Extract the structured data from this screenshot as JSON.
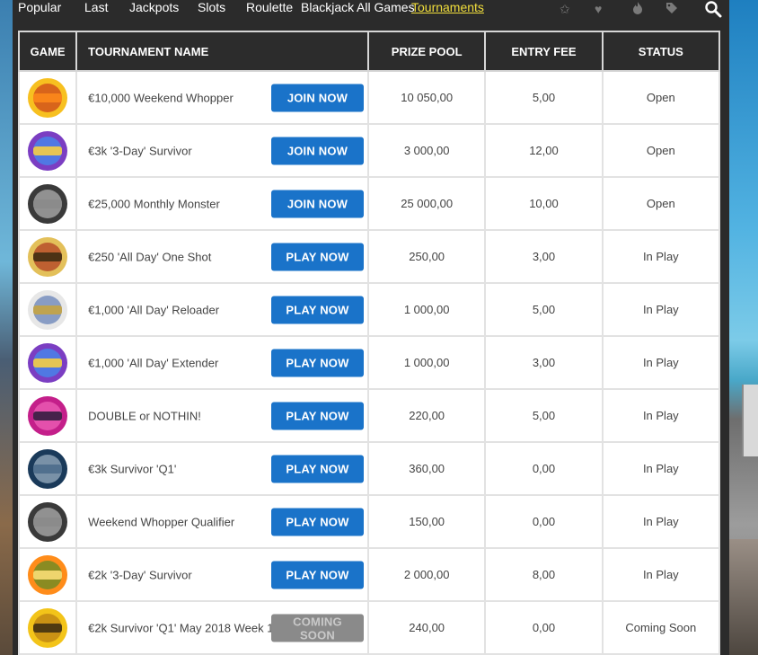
{
  "nav": {
    "links": [
      "Popular",
      "Last",
      "Jackpots",
      "Slots",
      "Roulette",
      "Blackjack",
      "All Games",
      "Tournaments"
    ],
    "active": "Tournaments",
    "icons": [
      "star-icon",
      "heart-icon",
      "fire-icon",
      "tag-icon",
      "search-icon"
    ]
  },
  "table": {
    "headers": {
      "game": "GAME",
      "name": "TOURNAMENT NAME",
      "prize": "PRIZE POOL",
      "fee": "ENTRY FEE",
      "status": "STATUS"
    },
    "rows": [
      {
        "name": "€10,000 Weekend Whopper",
        "button": "JOIN NOW",
        "prize": "10 050,00",
        "fee": "5,00",
        "status": "Open",
        "game_icon": "burning-desire-logo"
      },
      {
        "name": "€3k '3-Day' Survivor",
        "button": "JOIN NOW",
        "prize": "3 000,00",
        "fee": "12,00",
        "status": "Open",
        "game_icon": "lucky-witch-logo"
      },
      {
        "name": "€25,000 Monthly Monster",
        "button": "JOIN NOW",
        "prize": "25 000,00",
        "fee": "10,00",
        "status": "Open",
        "game_icon": "immortal-romance-logo"
      },
      {
        "name": "€250 'All Day' One Shot",
        "button": "PLAY NOW",
        "prize": "250,00",
        "fee": "3,00",
        "status": "In Play",
        "game_icon": "girls-with-guns-logo"
      },
      {
        "name": "€1,000 'All Day' Reloader",
        "button": "PLAY NOW",
        "prize": "1 000,00",
        "fee": "5,00",
        "status": "In Play",
        "game_icon": "leagues-of-fortune-logo"
      },
      {
        "name": "€1,000 'All Day' Extender",
        "button": "PLAY NOW",
        "prize": "1 000,00",
        "fee": "3,00",
        "status": "In Play",
        "game_icon": "lucky-witch-logo"
      },
      {
        "name": "DOUBLE or NOTHIN!",
        "button": "PLAY NOW",
        "prize": "220,00",
        "fee": "5,00",
        "status": "In Play",
        "game_icon": "ladies-nite-logo"
      },
      {
        "name": "€3k Survivor 'Q1'",
        "button": "PLAY NOW",
        "prize": "360,00",
        "fee": "0,00",
        "status": "In Play",
        "game_icon": "t2-logo"
      },
      {
        "name": "Weekend Whopper Qualifier",
        "button": "PLAY NOW",
        "prize": "150,00",
        "fee": "0,00",
        "status": "In Play",
        "game_icon": "immortal-romance-logo"
      },
      {
        "name": "€2k '3-Day' Survivor",
        "button": "PLAY NOW",
        "prize": "2 000,00",
        "fee": "8,00",
        "status": "In Play",
        "game_icon": "cool-buck-logo"
      },
      {
        "name": "€2k Survivor 'Q1' May 2018 Week 1",
        "button": "COMING SOON",
        "prize": "240,00",
        "fee": "0,00",
        "status": "Coming Soon",
        "game_icon": "gold-factory-logo"
      }
    ]
  },
  "colors": {
    "button": "#1a73c9",
    "button_disabled": "#8a8a8a",
    "active_nav": "#f2df3c",
    "panel": "#2b2b2b"
  }
}
